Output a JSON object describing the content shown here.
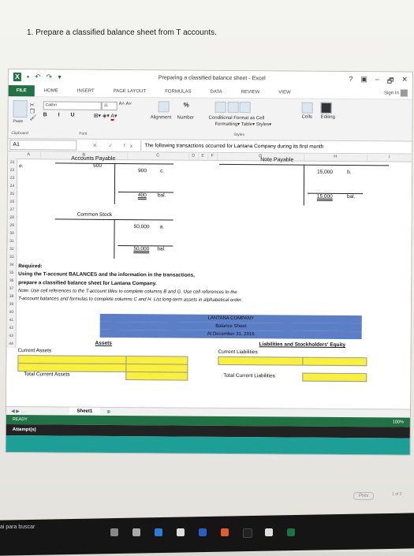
{
  "instruction": "1. Prepare a classified balance sheet from T accounts.",
  "window": {
    "title": "Preparing a classified balance sheet - Excel",
    "controls": [
      "?",
      "▣",
      "–",
      "🗗",
      "✕"
    ],
    "sign_in": "Sign In"
  },
  "tabs": [
    "FILE",
    "HOME",
    "INSERT",
    "PAGE LAYOUT",
    "FORMULAS",
    "DATA",
    "REVIEW",
    "VIEW"
  ],
  "ribbon": {
    "paste": "Paste",
    "font_name": "Calibri",
    "font_size": "11",
    "font_grow": "A˄ A˅",
    "biu": "B I U",
    "alignment": "Alignment",
    "number": "Number",
    "percent": "%",
    "conditional": "Conditional Format as Cell",
    "formatting": "Formatting▾ Table▾ Styles▾",
    "cells": "Cells",
    "editing": "Editing",
    "groups": [
      "Clipboard",
      "Font",
      "Styles"
    ]
  },
  "formula_bar": {
    "name_box": "A1",
    "fx": "fx",
    "content": "The following transactions occurred for Lantana Company during its first month"
  },
  "columns": [
    "A",
    "B",
    "C",
    "D",
    "E",
    "F",
    "G",
    "H",
    "I"
  ],
  "rows": [
    "21",
    "22",
    "23",
    "24",
    "25",
    "26",
    "27",
    "28",
    "29",
    "30",
    "31",
    "32",
    "33",
    "34",
    "35",
    "36",
    "37",
    "38",
    "39",
    "40",
    "41",
    "42",
    "43",
    "44"
  ],
  "sheet": {
    "r22_a": "e.",
    "accounts_payable": "Accounts Payable",
    "ap_500": "500",
    "ap_900": "900",
    "ap_900_ref": "c.",
    "ap_400": "400",
    "ap_400_ref": "bal.",
    "note_payable": "Note Payable",
    "np_15000": "15,000",
    "np_15000_ref": "b.",
    "np_bal": "15,000",
    "np_bal_ref": "bal.",
    "common_stock": "Common Stock",
    "cs_50000": "50,000",
    "cs_50000_ref": "a.",
    "cs_bal": "50,000",
    "cs_bal_ref": "bal.",
    "required": "Required:",
    "req1": "Using the T-account BALANCES and the information in the transactions,",
    "req2": "prepare a classified balance sheet for Lantana Company.",
    "note1": "Note: Use cell references to the T-account titles to complete columns B and G. Use cell references to the",
    "note2": "T-account balances and formulas to complete columns C and H. List long-term assets in alphabetical order.",
    "bs_company": "LANTANA COMPANY",
    "bs_title": "Balance Sheet",
    "bs_date": "At December 31, 2016",
    "assets": "Assets",
    "liab_equity": "Liabilities and Stockholders' Equity",
    "current_assets": "Current Assets",
    "current_liabilities": "Current Liabilities",
    "total_current_assets": "Total Current Assets",
    "total_current_liabilities": "Total Current Liabilities"
  },
  "sheet_tab": "Sheet1",
  "status": {
    "ready": "READY",
    "zoom": "100%"
  },
  "attempts": "Attempt(s)",
  "nav": {
    "prev": "Prev",
    "page": "1 of 2"
  },
  "taskbar": {
    "search": "ai para buscar"
  },
  "colors": {
    "excel_green": "#217346",
    "header_blue": "#5b7ec7",
    "highlight_yellow": "#f8f03a",
    "teal": "#1d9e97"
  }
}
